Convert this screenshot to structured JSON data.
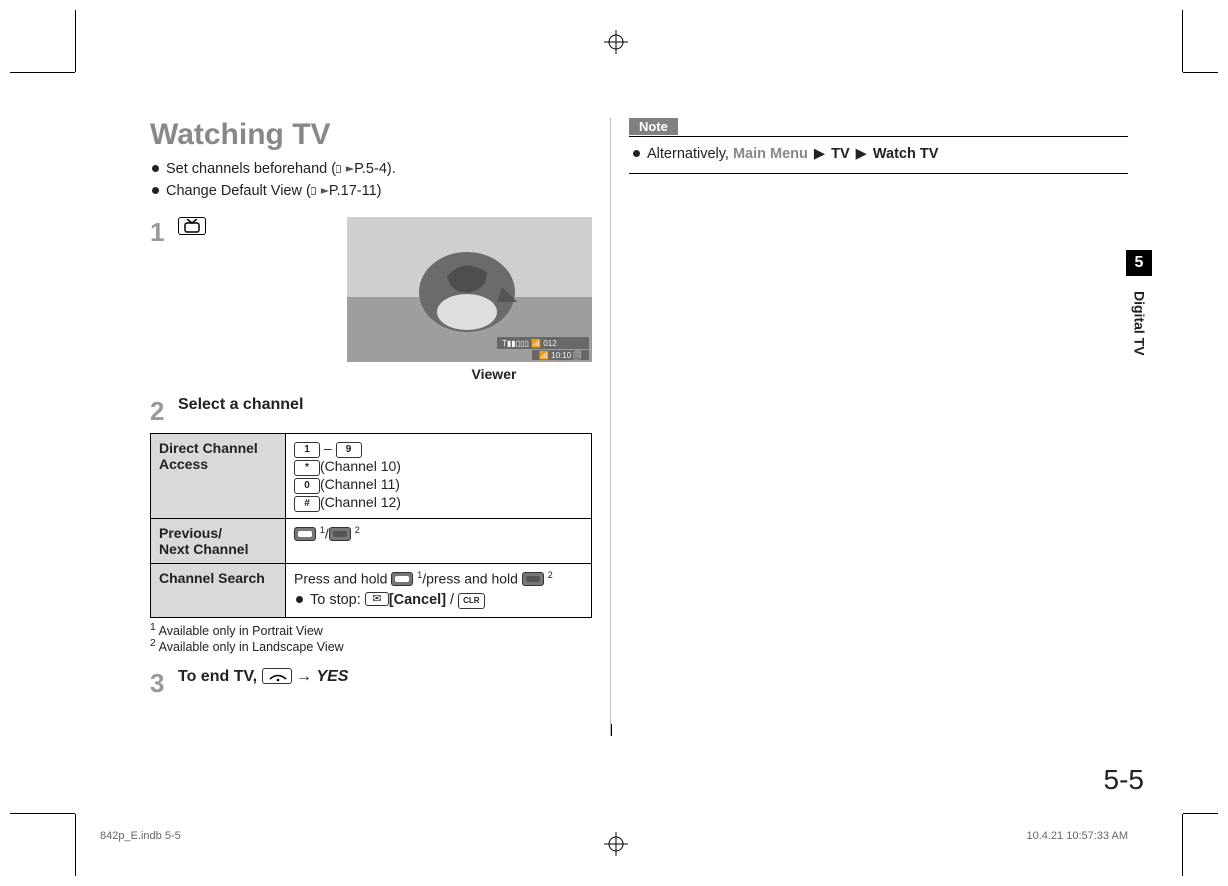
{
  "title": "Watching TV",
  "intro": [
    {
      "pre": "Set channels beforehand (",
      "ref": "P.5-4",
      "post": ")."
    },
    {
      "pre": "Change Default View (",
      "ref": "P.17-11",
      "post": ")"
    }
  ],
  "step1_num": "1",
  "viewer_caption": "Viewer",
  "step2_num": "2",
  "step2_title": "Select a channel",
  "table": {
    "rows": [
      {
        "label": "Direct Channel Access",
        "k1": "1",
        "dash": " – ",
        "k9": "9",
        "kstar": "*",
        "ch10": "(Channel 10)",
        "k0": "0",
        "ch11": "(Channel 11)",
        "khash": "#",
        "ch12": "(Channel 12)"
      },
      {
        "label": "Previous/\nNext Channel",
        "sup1": "1",
        "slash": "/",
        "sup2": "2"
      },
      {
        "label": "Channel Search",
        "press1": "Press and hold ",
        "sup1": "1",
        "slash": "/press and hold ",
        "sup2": "2",
        "stop_lead": "To stop: ",
        "cancel": "[Cancel]",
        "slash2": " / ",
        "clr": "CLR"
      }
    ]
  },
  "footnotes": {
    "f1": "Available only in Portrait View",
    "f2": "Available only in Landscape View"
  },
  "step3_num": "3",
  "step3_pre": "To end TV, ",
  "step3_arrow": " → ",
  "step3_yes": "YES",
  "note_tab": "Note",
  "note_body": {
    "lead": "Alternatively, ",
    "main_menu": "Main Menu",
    "seg_tv": "TV",
    "seg_watch": "Watch TV"
  },
  "side_tab": {
    "num": "5",
    "label": "Digital TV"
  },
  "page_num": "5-5",
  "footer": {
    "left": "842p_E.indb   5-5",
    "right": "10.4.21   10:57:33 AM"
  }
}
